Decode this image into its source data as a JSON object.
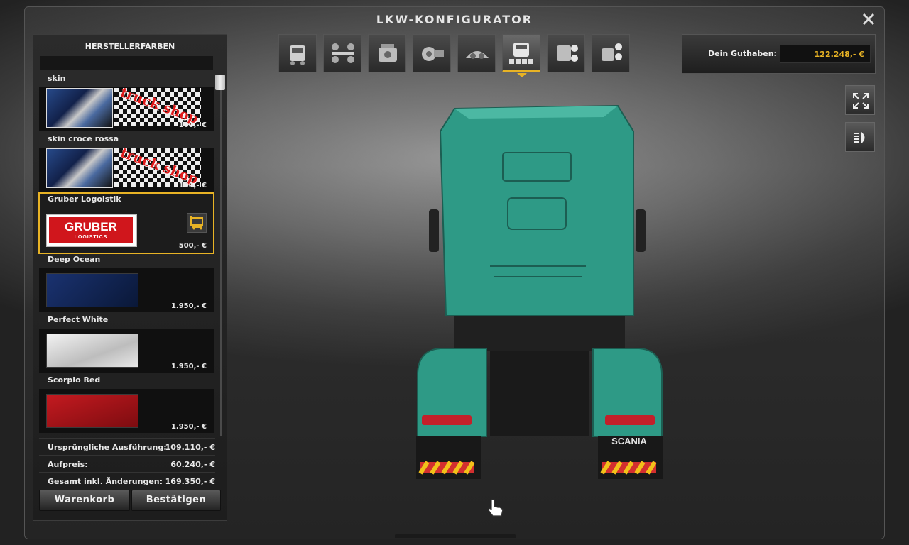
{
  "window": {
    "title": "LKW-KONFIGURATOR"
  },
  "panel": {
    "header": "HERSTELLERFARBEN",
    "items": [
      {
        "name": "skin",
        "price": "100,- €"
      },
      {
        "name": "skin croce rossa",
        "price": "100,- €"
      },
      {
        "name": "Gruber Logoistik",
        "price": "500,- €",
        "logo_text": "GRUBER",
        "logo_sub": "LOGISTICS"
      },
      {
        "name": "Deep Ocean",
        "price": "1.950,- €",
        "color": "#0e2150"
      },
      {
        "name": "Perfect White",
        "price": "1.950,- €",
        "color": "#d6d6d6"
      },
      {
        "name": "Scorpio Red",
        "price": "1.950,- €",
        "color": "#9b1217"
      }
    ],
    "thumb_text": "truck shop",
    "summary": [
      {
        "label": "Ursprüngliche Ausführung:",
        "value": "109.110,- €"
      },
      {
        "label": "Aufpreis:",
        "value": "60.240,- €"
      },
      {
        "label": "Gesamt inkl. Änderungen:",
        "value": "169.350,- €"
      }
    ],
    "cart_button": "Warenkorb",
    "confirm_button": "Bestätigen"
  },
  "tabs": [
    {
      "icon": "truck-cabin-icon"
    },
    {
      "icon": "chassis-icon"
    },
    {
      "icon": "engine-icon"
    },
    {
      "icon": "transmission-icon"
    },
    {
      "icon": "interior-icon"
    },
    {
      "icon": "paint-icon",
      "active": true
    },
    {
      "icon": "lights-icon"
    },
    {
      "icon": "accessories-icon"
    }
  ],
  "money": {
    "label": "Dein Guthaben:",
    "value": "122.248,- €"
  },
  "colors": {
    "accent": "#e8b325",
    "truck": "#2e9a86"
  }
}
